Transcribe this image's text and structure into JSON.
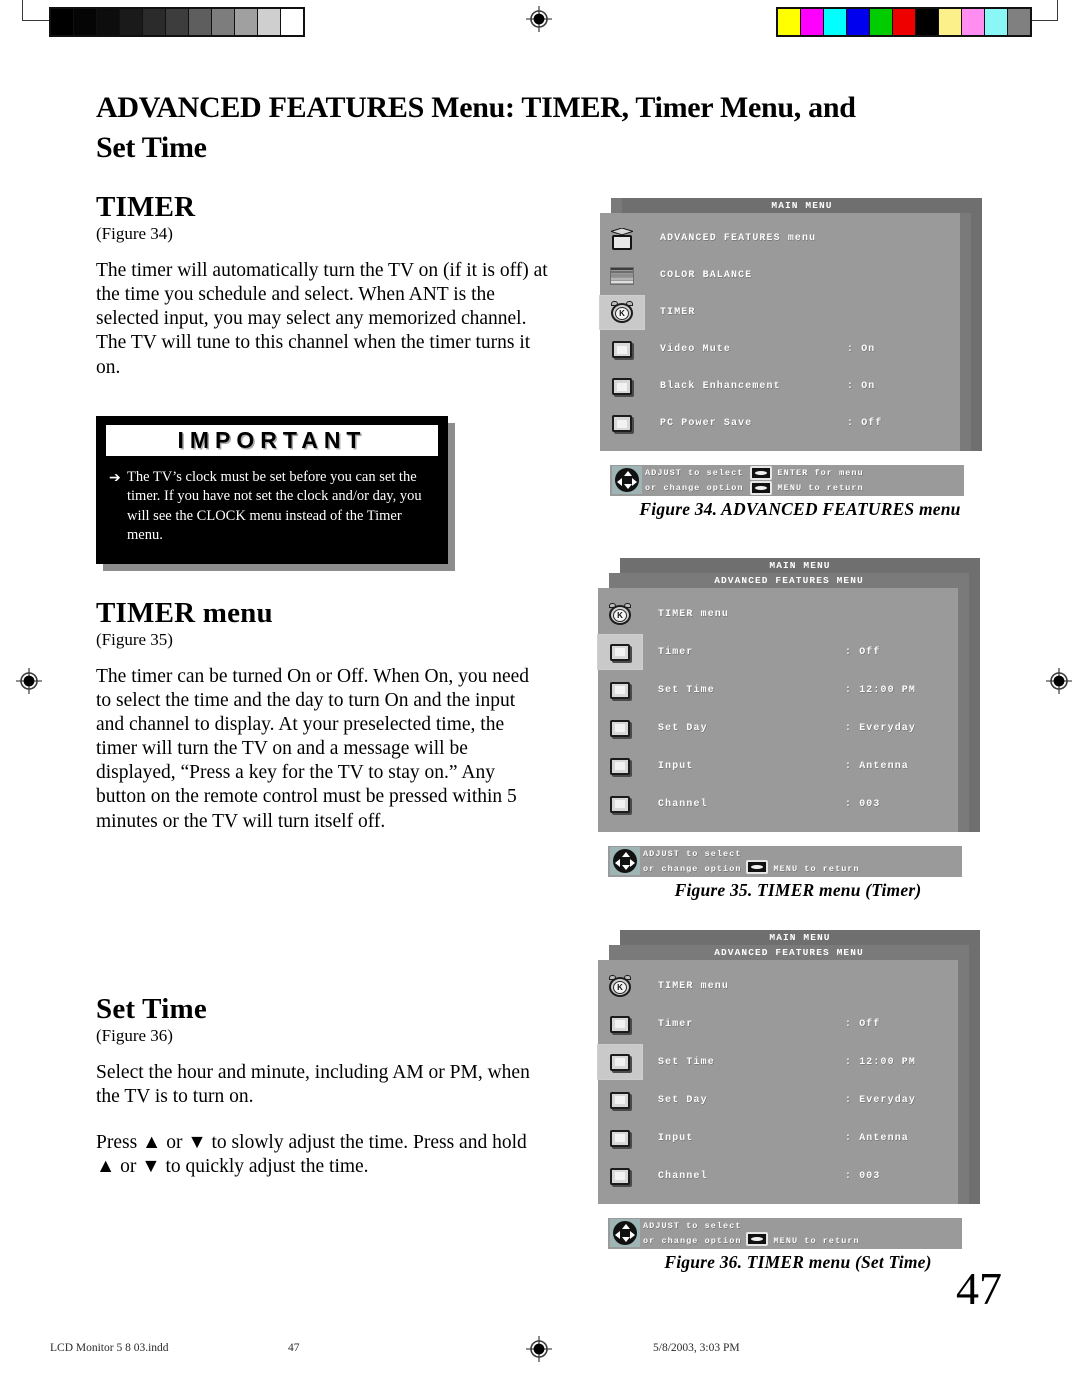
{
  "page": {
    "title_line1": "ADVANCED FEATURES Menu: TIMER, Timer Menu, and",
    "title_line2": "Set Time",
    "number": "47"
  },
  "sections": [
    {
      "heading": "TIMER",
      "figure_ref": "(Figure 34)",
      "body": "The timer will automatically turn the TV on (if it is off) at the time you schedule and select.  When ANT is the selected input, you may select any memorized channel.  The TV will tune to this channel when the timer turns it on."
    },
    {
      "heading": "TIMER menu",
      "figure_ref": "(Figure 35)",
      "body": "The timer can be turned On or Off.  When On, you need to select the time and the day to turn On and the input and channel to display.  At your preselected time, the timer will turn the TV on and a message will be displayed, “Press a key for the TV to stay on.” Any button on the remote control must be pressed within 5 minutes or the TV will turn itself off."
    },
    {
      "heading": "Set Time",
      "figure_ref": "(Figure 36)",
      "body": "Select the hour and minute, including AM or PM, when the TV is to turn on.",
      "body2": "Press ▲ or  ▼ to slowly adjust the time.  Press and hold ▲ or ▼ to quickly adjust the time."
    }
  ],
  "important": {
    "title": "IMPORTANT",
    "bullet": "➔",
    "text": "The TV’s clock must be set before you can set the timer.  If you have not set the clock and/or day, you will see the CLOCK menu instead of the Timer menu."
  },
  "figures": [
    {
      "id": "figure-34",
      "caption": "Figure 34.  ADVANCED FEATURES menu",
      "titlebar": "MAIN MENU",
      "subbar": null,
      "rows": [
        {
          "icon": "advanced-features-icon",
          "label": "ADVANCED FEATURES menu",
          "value": null,
          "highlighted": false
        },
        {
          "icon": "color-balance-icon",
          "label": "COLOR BALANCE",
          "value": null,
          "highlighted": false
        },
        {
          "icon": "timer-clock-icon",
          "label": "TIMER",
          "value": null,
          "highlighted": true
        },
        {
          "icon": "monitor-icon",
          "label": "Video Mute",
          "value": ": On",
          "highlighted": false
        },
        {
          "icon": "monitor-icon",
          "label": "Black Enhancement",
          "value": ": On",
          "highlighted": false
        },
        {
          "icon": "monitor-icon",
          "label": "PC Power Save",
          "value": ": Off",
          "highlighted": false
        }
      ],
      "footer": {
        "hint_line1": "ADJUST to select",
        "hint_line2": "or change option",
        "hint_line3": "ENTER for menu",
        "hint_line4": "MENU to return",
        "two_buttons": true
      }
    },
    {
      "id": "figure-35",
      "caption": "Figure  35.  TIMER menu (Timer)",
      "titlebar": "MAIN MENU",
      "subbar": "ADVANCED FEATURES MENU",
      "rows": [
        {
          "icon": "timer-clock-icon",
          "label": "TIMER menu",
          "value": null,
          "highlighted": false
        },
        {
          "icon": "monitor-icon",
          "label": "Timer",
          "value": ": Off",
          "highlighted": true
        },
        {
          "icon": "monitor-icon",
          "label": "Set Time",
          "value": ": 12:00 PM",
          "highlighted": false
        },
        {
          "icon": "monitor-icon",
          "label": "Set Day",
          "value": ": Everyday",
          "highlighted": false
        },
        {
          "icon": "monitor-icon",
          "label": "Input",
          "value": ": Antenna",
          "highlighted": false
        },
        {
          "icon": "monitor-icon",
          "label": "Channel",
          "value": ": 003",
          "highlighted": false
        }
      ],
      "footer": {
        "hint_line1": "ADJUST to select",
        "hint_line2": "or change option",
        "hint_line3": "",
        "hint_line4": "MENU to return",
        "two_buttons": false
      }
    },
    {
      "id": "figure-36",
      "caption": "Figure  36.  TIMER menu (Set Time)",
      "titlebar": "MAIN MENU",
      "subbar": "ADVANCED FEATURES MENU",
      "rows": [
        {
          "icon": "timer-clock-icon",
          "label": "TIMER menu",
          "value": null,
          "highlighted": false
        },
        {
          "icon": "monitor-icon",
          "label": "Timer",
          "value": ": Off",
          "highlighted": false
        },
        {
          "icon": "monitor-icon",
          "label": "Set Time",
          "value": ": 12:00 PM",
          "highlighted": true
        },
        {
          "icon": "monitor-icon",
          "label": "Set Day",
          "value": ": Everyday",
          "highlighted": false
        },
        {
          "icon": "monitor-icon",
          "label": "Input",
          "value": ": Antenna",
          "highlighted": false
        },
        {
          "icon": "monitor-icon",
          "label": "Channel",
          "value": ": 003",
          "highlighted": false
        }
      ],
      "footer": {
        "hint_line1": "ADJUST to select",
        "hint_line2": "or change option",
        "hint_line3": "",
        "hint_line4": "MENU to return",
        "two_buttons": false
      }
    }
  ],
  "print_marks": {
    "gray_wedge": [
      "#000000",
      "#050505",
      "#0d0d0d",
      "#1a1a1a",
      "#2b2b2b",
      "#3d3d3d",
      "#5e5e5e",
      "#7d7d7d",
      "#a0a0a0",
      "#cfcfcf",
      "#ffffff"
    ],
    "color_wedge": [
      "#ffff00",
      "#ff00ff",
      "#00ffff",
      "#0000ee",
      "#00cc00",
      "#ee0000",
      "#000000",
      "#fbf08a",
      "#ff8ef0",
      "#8af6f6",
      "#808080"
    ]
  },
  "footer": {
    "file": "LCD Monitor 5 8 03.indd",
    "page": "47",
    "date": "5/8/2003, 3:03 PM"
  }
}
